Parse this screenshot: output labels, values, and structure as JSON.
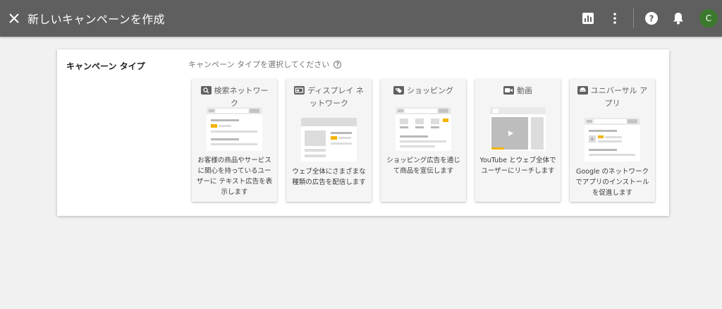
{
  "header": {
    "title": "新しいキャンペーンを作成",
    "avatar_initial": "C"
  },
  "main": {
    "section_label": "キャンペーン タイプ",
    "prompt": "キャンペーン タイプを選択してください",
    "cards": [
      {
        "title": "検索ネットワーク",
        "description": "お客様の商品やサービスに関心を持っているユーザーに テキスト広告を表示します",
        "icon": "search-icon"
      },
      {
        "title": "ディスプレイ ネットワーク",
        "description": "ウェブ全体にさまざまな種類の広告を配信します",
        "icon": "display-icon"
      },
      {
        "title": "ショッピング",
        "description": "ショッピング広告を通じて商品を宣伝します",
        "icon": "tag-icon"
      },
      {
        "title": "動画",
        "description": "YouTube とウェブ全体でユーザーにリーチします",
        "icon": "video-icon"
      },
      {
        "title": "ユニバーサル アプリ",
        "description": "Google のネットワークでアプリのインストールを促進します",
        "icon": "android-icon"
      }
    ]
  },
  "colors": {
    "topbar": "#5f5f5f",
    "avatar": "#3b7a2d",
    "highlight": "#f3b400"
  }
}
